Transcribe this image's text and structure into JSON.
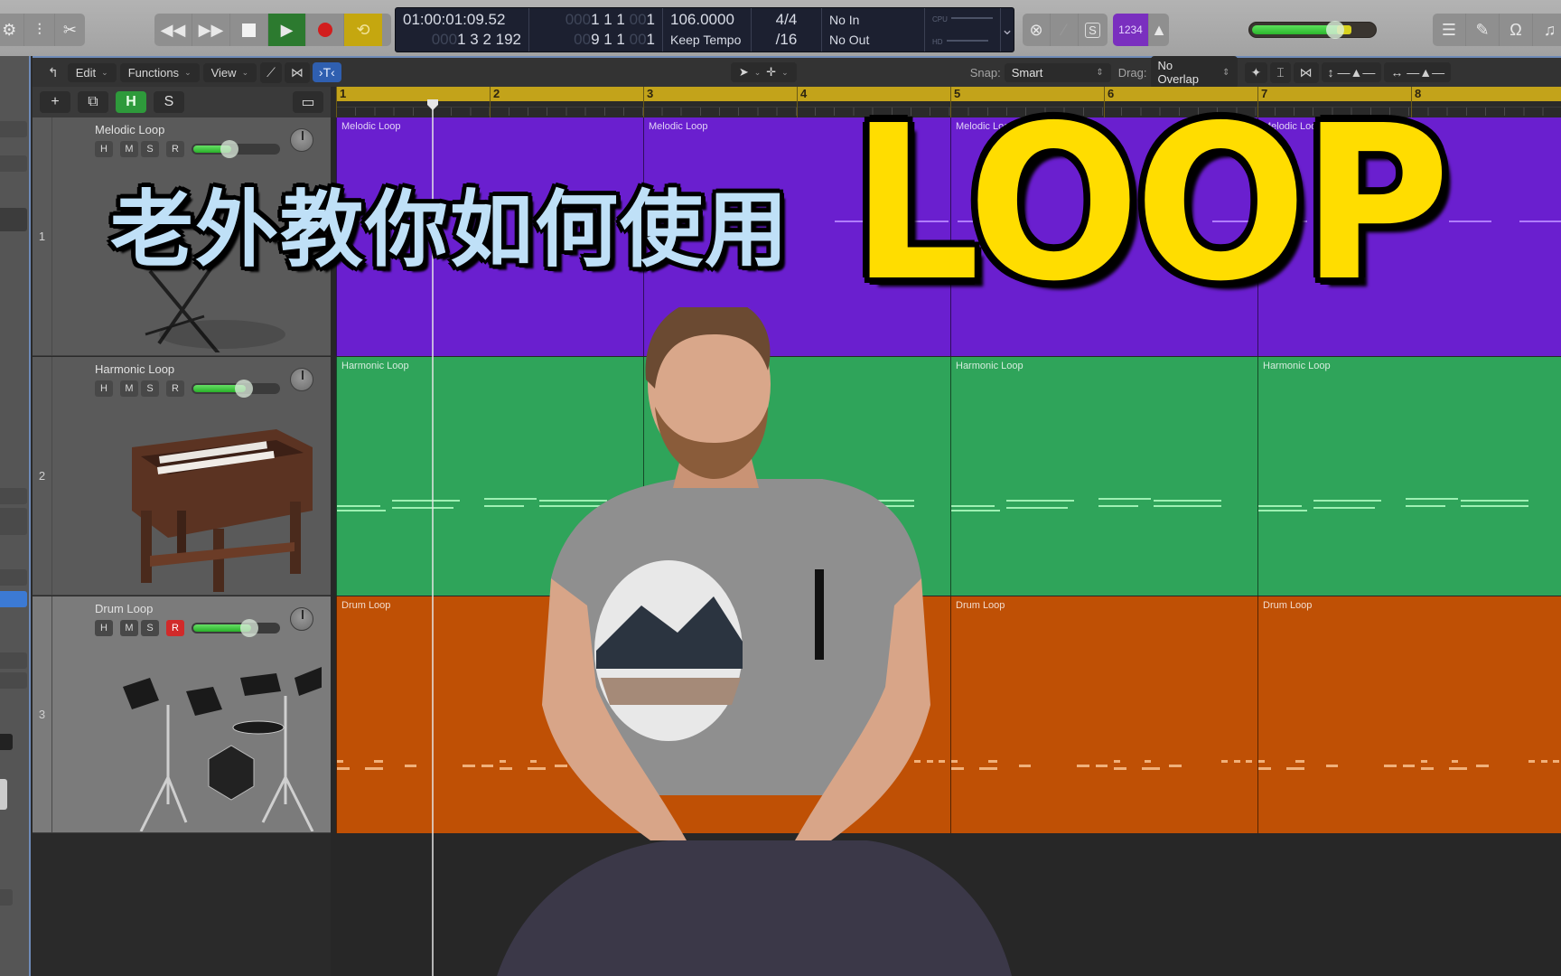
{
  "control_bar": {
    "left_tools": [
      "library-icon",
      "mixer-icon",
      "scissors-icon"
    ],
    "transport": {
      "rewind": "rewind-icon",
      "fast_forward": "fast-forward-icon",
      "stop": "stop-icon",
      "play": "play-icon",
      "record": "record-icon",
      "cycle": "cycle-icon"
    },
    "lcd": {
      "smpte": "01:00:01:09.52",
      "smpte_bars_prefix": "000",
      "smpte_bars": "1 3 2 192",
      "left_locator_prefix": "000",
      "left_locator": "1 1 1",
      "left_locator_tick_prefix": "00",
      "left_locator_tick": "1",
      "right_locator_prefix": "00",
      "right_locator": "9 1 1",
      "right_locator_tick_prefix": "00",
      "right_locator_tick": "1",
      "tempo": "106.0000",
      "tempo_mode": "Keep Tempo",
      "time_signature": "4/4",
      "division": "/16",
      "midi_in": "No In",
      "midi_out": "No Out",
      "cpu_label": "CPU",
      "hd_label": "HD"
    },
    "right_tools": {
      "replace": "replace-icon",
      "tuner": "tuner-icon",
      "solo": "S",
      "count_in": "1234",
      "metronome": "metronome-icon"
    },
    "master_volume": 0.74,
    "view_tools": [
      "list-editors-icon",
      "notepad-icon",
      "loop-browser-icon",
      "browser-icon"
    ]
  },
  "toolbar": {
    "back": "back-icon",
    "edit": "Edit",
    "functions": "Functions",
    "view": "View",
    "automation": "automation-icon",
    "flex": "flex-icon",
    "catch": "catch-icon",
    "pointer_tool": "pointer-icon",
    "pencil_tool": "crosshair-icon",
    "snap_label": "Snap:",
    "snap_value": "Smart",
    "drag_label": "Drag:",
    "drag_value": "No Overlap",
    "zoom_icons": [
      "waveform-zoom-icon",
      "vertical-fit-icon",
      "horizontal-fit-icon",
      "vertical-zoom-icon",
      "horizontal-zoom-icon"
    ]
  },
  "track_header_controls": {
    "add": "+",
    "duplicate": "duplicate-icon",
    "hide": "H",
    "solo": "S",
    "global_tracks": "global-tracks-icon"
  },
  "ruler": {
    "bars": [
      "1",
      "2",
      "3",
      "4",
      "5",
      "6",
      "7",
      "8"
    ]
  },
  "tracks": [
    {
      "number": "1",
      "name": "Melodic Loop",
      "color": "#6a1fcf",
      "instrument": "keyboard-stand",
      "volume": 0.45,
      "record_armed": false,
      "buttons": [
        "H",
        "M",
        "S",
        "R"
      ],
      "regions": [
        "Melodic Loop",
        "Melodic Loop",
        "Melodic Loop",
        "Melodic Loop"
      ]
    },
    {
      "number": "2",
      "name": "Harmonic Loop",
      "color": "#2fa45a",
      "instrument": "organ",
      "volume": 0.62,
      "record_armed": false,
      "buttons": [
        "H",
        "M",
        "S",
        "R"
      ],
      "regions": [
        "Harmonic Loop",
        "Harmonic Loop",
        "Harmonic Loop",
        "Harmonic Loop"
      ]
    },
    {
      "number": "3",
      "name": "Drum Loop",
      "color": "#bf5005",
      "instrument": "electronic-drum-kit",
      "volume": 0.68,
      "record_armed": true,
      "buttons": [
        "H",
        "M",
        "S",
        "R"
      ],
      "regions": [
        "Drum Loop",
        "Drum Loop",
        "Drum Loop",
        "Drum Loop"
      ]
    }
  ],
  "overlay": {
    "title_cn": "老外教你如何使用",
    "title_en": "LOOP",
    "title_cn_color": "#bfe0f7",
    "title_en_color": "#ffdd00"
  }
}
